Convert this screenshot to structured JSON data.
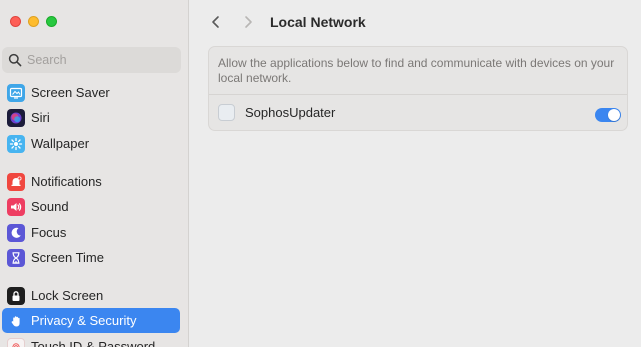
{
  "sidebar": {
    "search": {
      "placeholder": "Search"
    },
    "items": [
      {
        "label": "Screen Saver",
        "icon": "screen-saver-icon",
        "color": "#3fa6e8"
      },
      {
        "label": "Siri",
        "icon": "siri-icon",
        "color": "#1c1c3a"
      },
      {
        "label": "Wallpaper",
        "icon": "wallpaper-icon",
        "color": "#47b4f0"
      },
      {
        "label": "Notifications",
        "icon": "notifications-icon",
        "color": "#f0473f"
      },
      {
        "label": "Sound",
        "icon": "sound-icon",
        "color": "#ee3e62"
      },
      {
        "label": "Focus",
        "icon": "focus-moon-icon",
        "color": "#5c57d6"
      },
      {
        "label": "Screen Time",
        "icon": "screen-time-icon",
        "color": "#5c57d6"
      },
      {
        "label": "Lock Screen",
        "icon": "lock-icon",
        "color": "#1e1e1e"
      },
      {
        "label": "Privacy & Security",
        "icon": "privacy-hand-icon",
        "color": "#3b86f0",
        "active": true
      },
      {
        "label": "Touch ID & Password",
        "icon": "fingerprint-icon",
        "color": "#f05a5a"
      }
    ]
  },
  "header": {
    "title": "Local Network"
  },
  "panel": {
    "description": "Allow the applications below to find and communicate with devices on your local network.",
    "apps": [
      {
        "name": "SophosUpdater",
        "enabled": true
      }
    ]
  },
  "colors": {
    "accent": "#3b86f0"
  }
}
